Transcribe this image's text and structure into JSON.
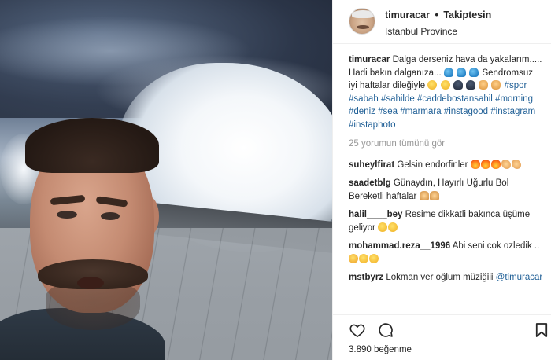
{
  "post": {
    "author": "timuracar",
    "follow_status": "Takiptesin",
    "dot": "•",
    "location": "Istanbul Province",
    "caption": {
      "text_1": "Dalga derseniz hava da yakalarım..... Hadi bakın dalganıza...",
      "text_2": "Sendromsuz iyi haftalar dileğiyle",
      "hashtags": "#spor #sabah #sahilde #caddebostansahil #morning #deniz #sea #marmara #instagood #instagram #instaphoto"
    },
    "view_all_comments": "25 yorumun tümünü gör",
    "comments": [
      {
        "user": "suheylfirat",
        "text": "Gelsin endorfinler"
      },
      {
        "user": "saadetblg",
        "text": "Günaydın, Hayırlı Uğurlu Bol Bereketli haftalar"
      },
      {
        "user": "halil____bey",
        "text": "Resime dikkatli bakınca üşüme geliyor"
      },
      {
        "user": "mohammad.reza__1996",
        "text": "Abi seni cok ozledik .."
      },
      {
        "user": "mstbyrz",
        "text": "Lokman ver oğlum müziğiii",
        "mention": "@timuracar"
      }
    ],
    "likes": "3.890 beğenme"
  },
  "icons": {
    "like": "heart-icon",
    "comment": "comment-bubble-icon",
    "save": "bookmark-icon"
  },
  "colors": {
    "hashtag": "#1f5f96",
    "muted": "#999999",
    "text": "#262626"
  }
}
